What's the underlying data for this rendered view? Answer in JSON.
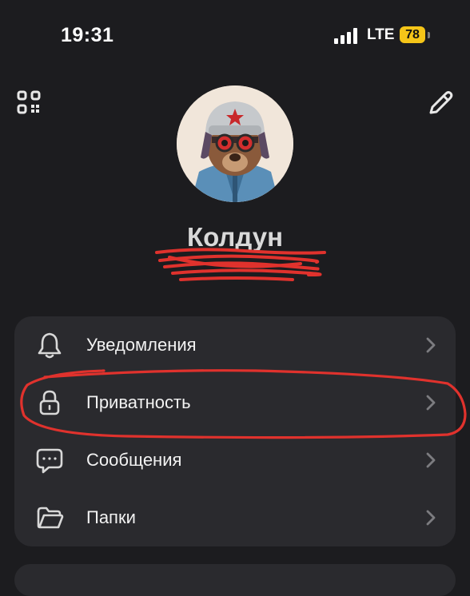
{
  "status_bar": {
    "time": "19:31",
    "network": "LTE",
    "battery_level": "78",
    "battery_color": "#f5c518"
  },
  "header": {
    "qr_icon": "qr-code-icon",
    "edit_icon": "pencil-icon"
  },
  "profile": {
    "name": "Колдун",
    "avatar": "bear-in-ushanka-avatar"
  },
  "menu": {
    "items": [
      {
        "label": "Уведомления",
        "icon": "bell-icon"
      },
      {
        "label": "Приватность",
        "icon": "lock-icon"
      },
      {
        "label": "Сообщения",
        "icon": "message-icon"
      },
      {
        "label": "Папки",
        "icon": "folder-icon"
      }
    ]
  },
  "annotations": {
    "highlight_color": "#e0322d"
  }
}
